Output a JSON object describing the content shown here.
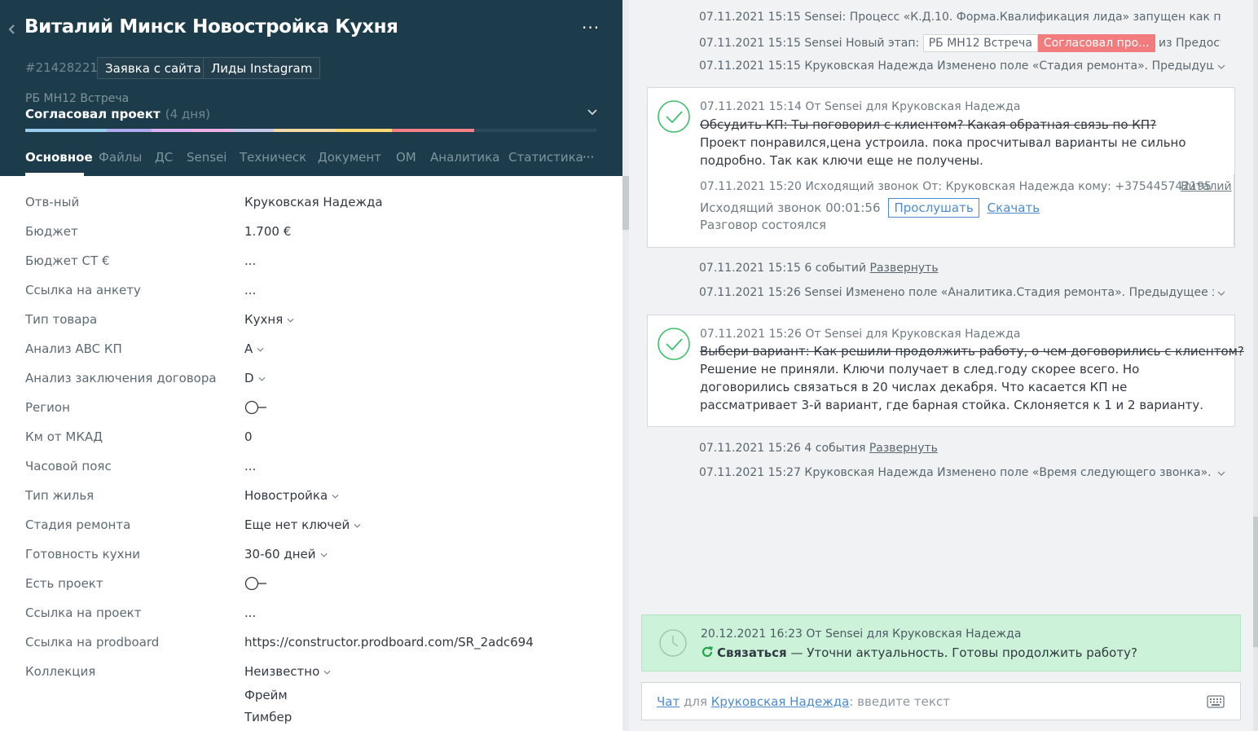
{
  "lead": {
    "title": "Виталий Минск Новостройка Кухня",
    "id": "#21428221",
    "tags": [
      "Заявка с сайта",
      "Лиды Instagram"
    ],
    "pipeline": "РБ МН12 Встреча",
    "stage": "Согласовал проект",
    "stage_age": "(4 дня)",
    "more_label": "···"
  },
  "tabs": [
    "Основное",
    "Файлы",
    "ДС",
    "Sensei",
    "Техническ",
    "Документ",
    "ОМ",
    "Аналитика",
    "Статистика"
  ],
  "tabs_more": "···",
  "fields": [
    {
      "label": "Отв-ный",
      "value": "Круковская Надежда"
    },
    {
      "label": "Бюджет",
      "value": "1.700 €"
    },
    {
      "label": "Бюджет СТ €",
      "value": "..."
    },
    {
      "label": "Ссылка на анкету",
      "value": "..."
    },
    {
      "label": "Тип товара",
      "value": "Кухня"
    },
    {
      "label": "Анализ ABC КП",
      "value": "A"
    },
    {
      "label": "Анализ заключения договора",
      "value": "D"
    },
    {
      "label": "Регион",
      "value": ""
    },
    {
      "label": "Км от МКАД",
      "value": "0"
    },
    {
      "label": "Часовой пояс",
      "value": "..."
    },
    {
      "label": "Тип жилья",
      "value": "Новостройка"
    },
    {
      "label": "Стадия ремонта",
      "value": "Еще нет ключей"
    },
    {
      "label": "Готовность кухни",
      "value": "30-60 дней"
    },
    {
      "label": "Есть проект",
      "value": ""
    },
    {
      "label": "Ссылка на проект",
      "value": "..."
    },
    {
      "label": "Ссылка на prodboard",
      "value": "https://constructor.prodboard.com/SR_2adc694"
    },
    {
      "label": "Коллекция",
      "value": "Неизвестно"
    }
  ],
  "collection_extra": [
    "Фрейм",
    "Тимбер"
  ],
  "feed": {
    "line1": "07.11.2021 15:15 Sensei: Процесс «К.Д.10. Форма.Квалификация лида» запущен как подпроцесс",
    "line2_prefix": "07.11.2021 15:15 Sensei Новый этап:",
    "line2_tag1": "РБ МН12 Встреча",
    "line2_tag2": "Согласовал про...",
    "line2_suffix": "из Предоставил КП",
    "line3": "07.11.2021 15:15 Круковская Надежда Изменено поле «Стадия ремонта». Предыдущее значение «",
    "card1": {
      "meta": "07.11.2021 15:14  От Sensei для Круковская Надежда",
      "strike": "Обсудить КП: Ты поговорил с клиентом? Какая обратная связь по КП?",
      "text": "Проект понравился,цена устроила. пока просчитывал варианты не сильно подробно. Так как ключи еще не получены.",
      "call_meta": "07.11.2021 15:20 Исходящий звонок От: Круковская Надежда кому: +375445742195",
      "call_author": "Виталий",
      "call_duration": "Исходящий звонок 00:01:56",
      "listen": "Прослушать",
      "download": "Скачать",
      "call_result": "Разговор состоялся"
    },
    "events1_text": "07.11.2021 15:15 6 событий",
    "expand_label": "Развернуть",
    "line4": "07.11.2021 15:26 Sensei Изменено поле «Аналитика.Стадия ремонта». Предыдущее значение «Пом",
    "card2": {
      "meta": "07.11.2021 15:26  От Sensei для Круковская Надежда",
      "strike": "Выбери вариант: Как решили продолжить работу, о чем договорились с клиентом?",
      "text": "Решение не приняли. Ключи получает в след.году скорее всего. Но договорились связаться в 20 числах декабря. Что касается КП не рассматривает 3-й вариант, где барная стойка. Склоняется к 1 и 2 варианту."
    },
    "events2_text": "07.11.2021 15:26 4 события",
    "line5": "07.11.2021 15:27 Круковская Надежда Изменено поле «Время следующего звонка». Предыдущее з"
  },
  "task": {
    "meta": "20.12.2021 16:23 От Sensei для Круковская Надежда",
    "type": "Связаться",
    "text": " — Уточни актуальность. Готовы продолжить работу?"
  },
  "chat": {
    "mode": "Чат",
    "for": " для ",
    "recipient": "Круковская Надежда",
    "placeholder": ": введите текст"
  },
  "colors": {
    "header_bg": "#1d3c4b",
    "task_bg": "#ccf3da",
    "stage_tag_red": "#f27c7d",
    "link_blue": "#4c8bd3",
    "check_green": "#3fbf6a"
  }
}
